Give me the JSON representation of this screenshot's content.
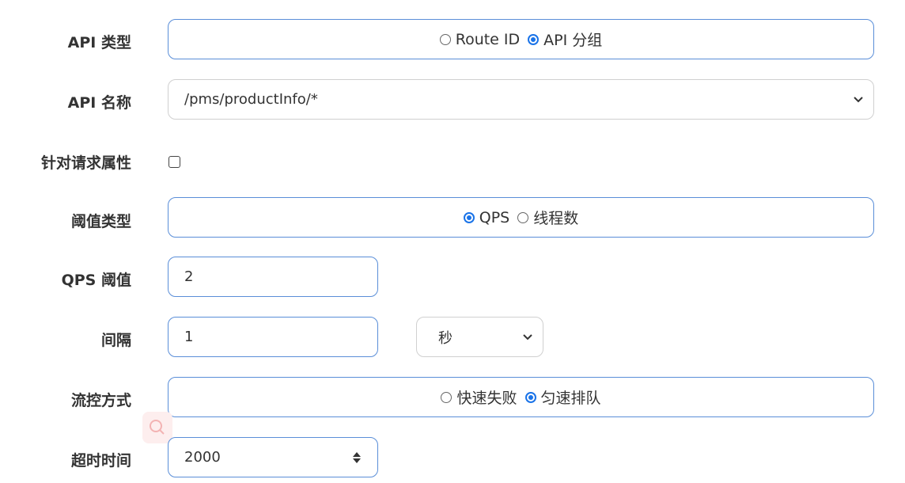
{
  "form": {
    "api_type": {
      "label": "API 类型",
      "options": [
        "Route ID",
        "API 分组"
      ],
      "selected": "API 分组"
    },
    "api_name": {
      "label": "API 名称",
      "value": "/pms/productInfo/*"
    },
    "request_attr": {
      "label": "针对请求属性",
      "checked": false
    },
    "threshold_type": {
      "label": "阈值类型",
      "options": [
        "QPS",
        "线程数"
      ],
      "selected": "QPS"
    },
    "qps_threshold": {
      "label": "QPS 阈值",
      "value": "2"
    },
    "interval": {
      "label": "间隔",
      "value": "1",
      "unit": "秒"
    },
    "flow_mode": {
      "label": "流控方式",
      "options": [
        "快速失败",
        "匀速排队"
      ],
      "selected": "匀速排队"
    },
    "timeout": {
      "label": "超时时间",
      "value": "2000"
    }
  },
  "colors": {
    "border_active": "#5a8ed8",
    "radio_selected": "#1a73e8",
    "label_text": "#333333"
  },
  "icons": {
    "dropdown": "chevron-down-icon",
    "spinner": "spinner-arrows-icon",
    "search": "search-icon"
  }
}
